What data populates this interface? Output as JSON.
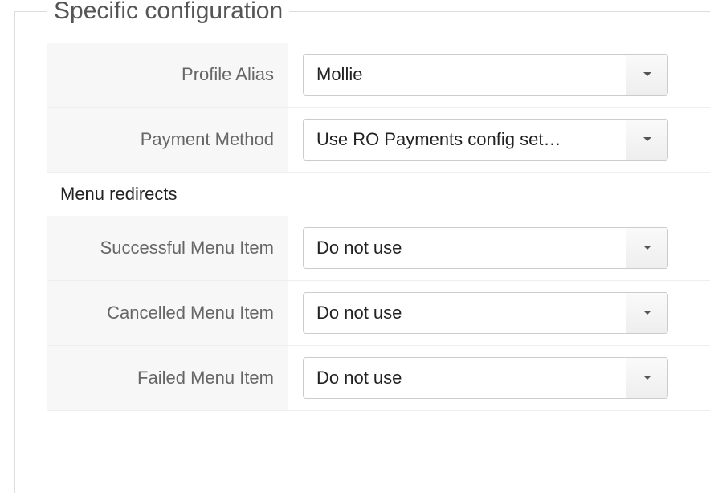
{
  "legend": "Specific configuration",
  "fields": {
    "profile_alias": {
      "label": "Profile Alias",
      "value": "Mollie"
    },
    "payment_method": {
      "label": "Payment Method",
      "value": "Use RO Payments config set…"
    }
  },
  "section_heading": "Menu redirects",
  "redirects": {
    "success": {
      "label": "Successful Menu Item",
      "value": "Do not use"
    },
    "cancelled": {
      "label": "Cancelled Menu Item",
      "value": "Do not use"
    },
    "failed": {
      "label": "Failed Menu Item",
      "value": "Do not use"
    }
  }
}
